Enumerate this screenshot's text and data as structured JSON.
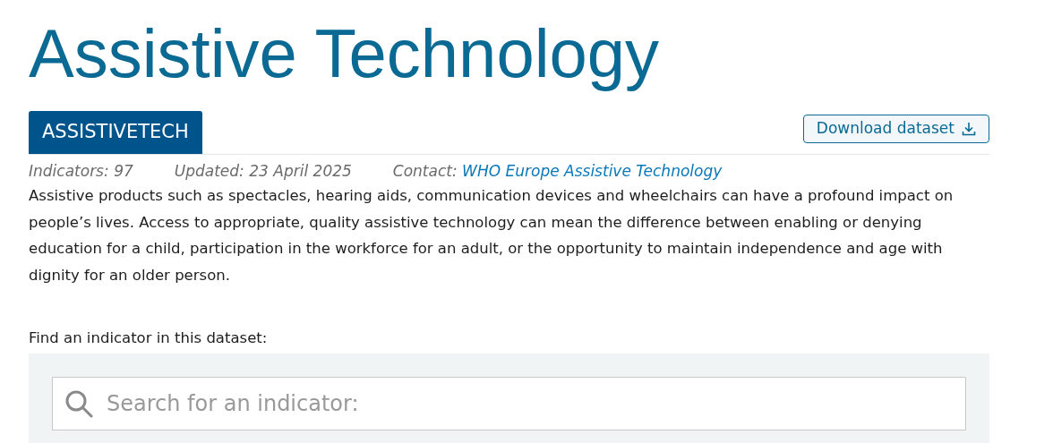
{
  "title": "Assistive Technology",
  "code_badge": "ASSISTIVETECH",
  "download_button": {
    "label": "Download dataset"
  },
  "meta": [
    {
      "label": "Indicators:",
      "value": "97",
      "kind": "text"
    },
    {
      "label": "Updated:",
      "value": "23 April 2025",
      "kind": "text"
    },
    {
      "label": "Contact:",
      "value": "WHO Europe Assistive Technology",
      "kind": "link"
    }
  ],
  "description": "Assistive products such as spectacles, hearing aids, communication devices and wheelchairs can have a profound impact on people’s lives. Access to appropriate, quality assistive technology can mean the difference between enabling or denying education for a child, participation in the workforce for an adult, or the opportunity to maintain independence and age with dignity for an older person.",
  "search": {
    "label": "Find an indicator in this dataset:",
    "placeholder": "Search for an indicator:"
  }
}
